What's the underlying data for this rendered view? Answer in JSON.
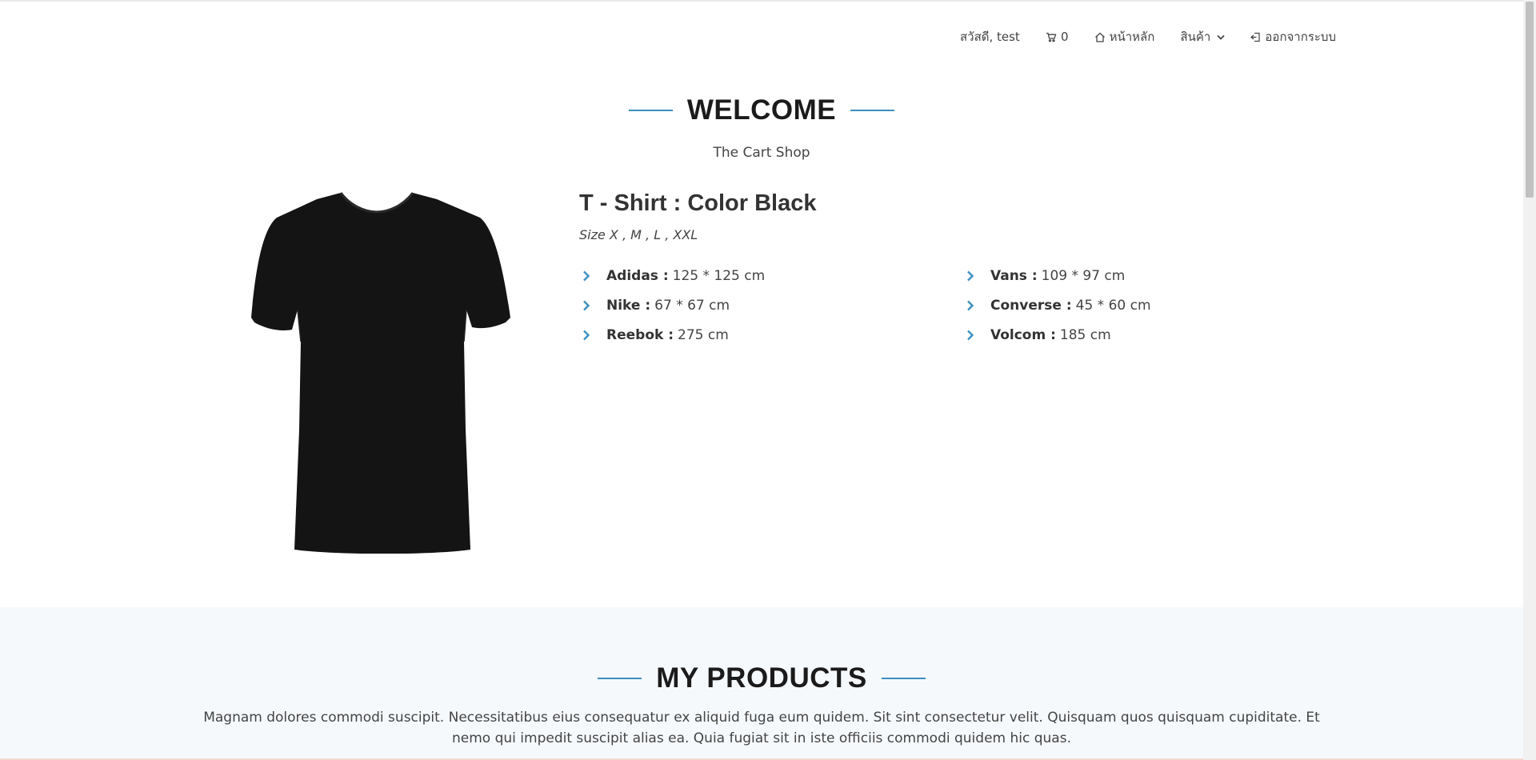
{
  "nav": {
    "greeting": "สวัสดี, test",
    "cart_count": "0",
    "home": "หน้าหลัก",
    "products": "สินค้า",
    "logout": "ออกจากระบบ"
  },
  "welcome": {
    "title": "WELCOME",
    "subtitle": "The Cart Shop"
  },
  "product": {
    "title": "T - Shirt : Color Black",
    "sizes": "Size X , M , L , XXL",
    "specs_left": [
      {
        "brand": "Adidas :",
        "value": "125 * 125 cm"
      },
      {
        "brand": "Nike :",
        "value": "67 * 67 cm"
      },
      {
        "brand": "Reebok :",
        "value": "275 cm"
      }
    ],
    "specs_right": [
      {
        "brand": "Vans :",
        "value": "109 * 97 cm"
      },
      {
        "brand": "Converse :",
        "value": "45 * 60 cm"
      },
      {
        "brand": "Volcom :",
        "value": "185 cm"
      }
    ]
  },
  "products_section": {
    "title": "MY PRODUCTS",
    "description": "Magnam dolores commodi suscipit. Necessitatibus eius consequatur ex aliquid fuga eum quidem. Sit sint consectetur velit. Quisquam quos quisquam cupiditate. Et nemo qui impedit suscipit alias ea. Quia fugiat sit in iste officiis commodi quidem hic quas."
  },
  "colors": {
    "accent": "#3b8fbf",
    "section_bg": "#f6f9fc",
    "heading": "#1b1b1b"
  }
}
